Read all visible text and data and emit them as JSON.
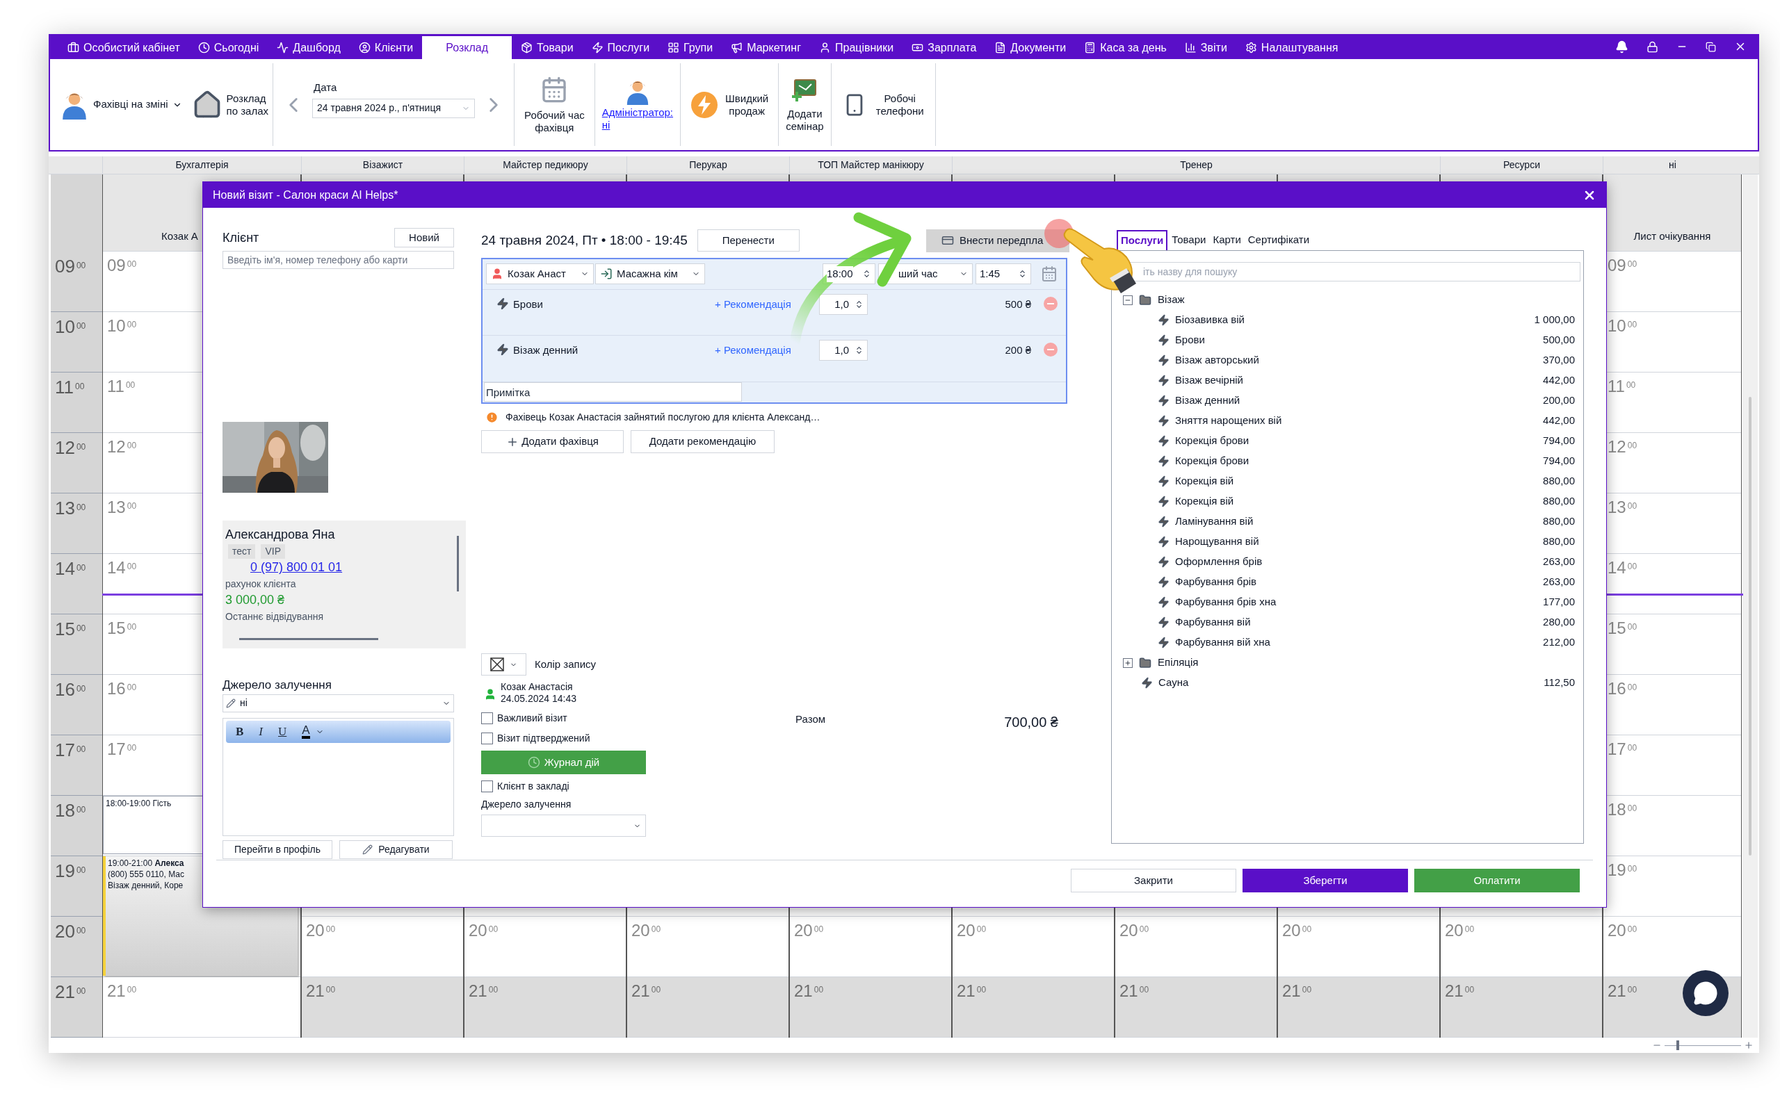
{
  "menu": [
    {
      "label": "Особистий кабінет",
      "selected": false
    },
    {
      "label": "Сьогодні",
      "selected": false
    },
    {
      "label": "Дашборд",
      "selected": false
    },
    {
      "label": "Клієнти",
      "selected": false
    },
    {
      "label": "Розклад",
      "selected": true
    },
    {
      "label": "Товари",
      "selected": false
    },
    {
      "label": "Послуги",
      "selected": false
    },
    {
      "label": "Групи",
      "selected": false
    },
    {
      "label": "Маркетинг",
      "selected": false
    },
    {
      "label": "Працівники",
      "selected": false
    },
    {
      "label": "Зарплата",
      "selected": false
    },
    {
      "label": "Документи",
      "selected": false
    },
    {
      "label": "Каса за день",
      "selected": false
    },
    {
      "label": "Звіти",
      "selected": false
    },
    {
      "label": "Налаштування",
      "selected": false
    }
  ],
  "toolbar": {
    "staff_on_shift": "Фахівці на зміні",
    "rooms": [
      "Розклад",
      "по залах"
    ],
    "date_label": "Дата",
    "date_value": "24 травня 2024 р., п'ятниця",
    "work_hours": [
      "Робочий час",
      "фахівця"
    ],
    "admin": [
      "Адміністратор:",
      "ні"
    ],
    "quick_sale": [
      "Швидкий",
      "продаж"
    ],
    "seminar": [
      "Додати",
      "семінар"
    ],
    "phones": [
      "Робочі",
      "телефони"
    ]
  },
  "calendar": {
    "time_axis": [
      {
        "hour": "09",
        "minutes": "00"
      },
      {
        "hour": "10",
        "minutes": "00"
      },
      {
        "hour": "11",
        "minutes": "00"
      },
      {
        "hour": "12",
        "minutes": "00"
      },
      {
        "hour": "13",
        "minutes": "00"
      },
      {
        "hour": "14",
        "minutes": "00"
      },
      {
        "hour": "15",
        "minutes": "00"
      },
      {
        "hour": "16",
        "minutes": "00"
      },
      {
        "hour": "17",
        "minutes": "00"
      },
      {
        "hour": "18",
        "minutes": "00"
      },
      {
        "hour": "19",
        "minutes": "00"
      },
      {
        "hour": "20",
        "minutes": "00"
      },
      {
        "hour": "21",
        "minutes": "00"
      }
    ],
    "groups": [
      {
        "label": "Бухгалтерія",
        "columns": [
          {
            "name": "Козак А",
            "slots": [
              {
                "kind": "hour",
                "hour": "09",
                "minutes": "00"
              },
              {
                "kind": "hour",
                "hour": "10",
                "minutes": "00"
              },
              {
                "kind": "hour",
                "hour": "11",
                "minutes": "00"
              },
              {
                "kind": "hour",
                "hour": "12",
                "minutes": "00"
              },
              {
                "kind": "hour",
                "hour": "13",
                "minutes": "00"
              },
              {
                "kind": "hour",
                "hour": "14",
                "minutes": "00"
              },
              {
                "kind": "hour",
                "hour": "15",
                "minutes": "00"
              },
              {
                "kind": "hour",
                "hour": "16",
                "minutes": "00"
              },
              {
                "kind": "hour",
                "hour": "17",
                "minutes": "00"
              },
              {
                "kind": "event",
                "lines": [
                  "18:00-19:00  Гість"
                ]
              },
              {
                "kind": "long_event",
                "lines": [
                  "19:00-21:00 **Алекса**",
                  "(800) 555 0110, Мас",
                  "Візаж денний, Коре"
                ]
              },
              {
                "kind": "hour",
                "hour": "21",
                "minutes": "00"
              }
            ]
          }
        ]
      },
      {
        "label": "Візажист",
        "columns": [
          {
            "hour_labels": [
              {
                "hour": "20",
                "minutes": "00",
                "off": false
              },
              {
                "hour": "21",
                "minutes": "00",
                "off": true
              }
            ]
          }
        ]
      },
      {
        "label": "Майстер педикюру",
        "columns": [
          {
            "hour_labels": [
              {
                "hour": "20",
                "minutes": "00",
                "off": false
              },
              {
                "hour": "21",
                "minutes": "00",
                "off": true
              }
            ]
          }
        ]
      },
      {
        "label": "Перукар",
        "columns": [
          {
            "hour_labels": [
              {
                "hour": "20",
                "minutes": "00",
                "off": false
              },
              {
                "hour": "21",
                "minutes": "00",
                "off": true
              }
            ]
          }
        ]
      },
      {
        "label": "ТОП Майстер манікюру",
        "columns": [
          {
            "hour_labels": [
              {
                "hour": "20",
                "minutes": "00",
                "off": false
              },
              {
                "hour": "21",
                "minutes": "00",
                "off": true
              }
            ]
          }
        ]
      },
      {
        "label": "Тренер",
        "columns": [
          {
            "hour_labels": [
              {
                "hour": "20",
                "minutes": "00",
                "off": false
              },
              {
                "hour": "21",
                "minutes": "00",
                "off": true
              }
            ]
          },
          {
            "hour_labels": [
              {
                "hour": "20",
                "minutes": "00",
                "off": false
              },
              {
                "hour": "21",
                "minutes": "00",
                "off": true
              }
            ]
          },
          {
            "hour_labels": [
              {
                "hour": "20",
                "minutes": "00",
                "off": false
              },
              {
                "hour": "21",
                "minutes": "00",
                "off": true
              }
            ]
          }
        ]
      },
      {
        "label": "Ресурси",
        "columns": [
          {
            "hour_labels": [
              {
                "hour": "20",
                "minutes": "00",
                "off": false
              },
              {
                "hour": "21",
                "minutes": "00",
                "off": true
              }
            ]
          }
        ]
      },
      {
        "label": "ні",
        "columns": [
          {
            "name": "Лист очікування",
            "hour_labels": [
              {
                "hour": "09",
                "minutes": "00",
                "off": false
              },
              {
                "hour": "10",
                "minutes": "00",
                "off": false
              },
              {
                "hour": "11",
                "minutes": "00",
                "off": false
              },
              {
                "hour": "12",
                "minutes": "00",
                "off": false
              },
              {
                "hour": "13",
                "minutes": "00",
                "off": false
              },
              {
                "hour": "14",
                "minutes": "00",
                "off": false
              },
              {
                "hour": "15",
                "minutes": "00",
                "off": false
              },
              {
                "hour": "16",
                "minutes": "00",
                "off": false
              },
              {
                "hour": "17",
                "minutes": "00",
                "off": false
              },
              {
                "hour": "18",
                "minutes": "00",
                "off": false
              },
              {
                "hour": "19",
                "minutes": "00",
                "off": false
              },
              {
                "hour": "20",
                "minutes": "00",
                "off": false
              },
              {
                "hour": "21",
                "minutes": "00",
                "off": true
              }
            ]
          }
        ]
      }
    ]
  },
  "zoom_slider": {
    "level": 0.15
  },
  "dialog": {
    "title": "Новий візит - Салон краси AI Helps*",
    "client": {
      "label": "Клієнт",
      "new_button": "Новий",
      "search_placeholder": "Введіть ім'я, номер телефону або карти",
      "name": "Александрова Яна",
      "tags": [
        {
          "label": "тест"
        },
        {
          "label": "VIP"
        }
      ],
      "phone": "0 (97) 800 01 01",
      "account_label": "рахунок клієнта",
      "balance": "3 000,00 ₴",
      "last_visit_label": "Останнє відвідування",
      "source_label": "Джерело залучення",
      "source_value": "ні",
      "format_buttons": [
        {
          "kind": "bold",
          "label": "B"
        },
        {
          "kind": "italic",
          "label": "I"
        },
        {
          "kind": "underline",
          "label": "U"
        },
        {
          "kind": "color",
          "label": "A"
        }
      ],
      "profile_button": "Перейти в профіль",
      "edit_button": "Редагувати"
    },
    "visit": {
      "heading": "24 травня 2024, Пт • 18:00 - 19:45",
      "move_button": "Перенести",
      "prepay_button": "Внести передпла",
      "staff": "Козак Анаст",
      "room": "Масажна кім",
      "start_time": "18:00",
      "time_mode": "ший час",
      "duration": "1:45",
      "services": [
        {
          "name": "Брови",
          "recommend": "+ Рекомендація",
          "quantity": "1,0",
          "price": "500 ₴"
        },
        {
          "name": "Візаж денний",
          "recommend": "+ Рекомендація",
          "quantity": "1,0",
          "price": "200 ₴"
        }
      ],
      "note_placeholder": "Примітка",
      "warning": "Фахівець Козак Анастасія зайнятий послугою для клієнта Александ…",
      "add_staff_button": "Додати фахівця",
      "add_recommendation_button": "Додати рекомендацію",
      "color_label": "Колір запису",
      "created_by": "Козак Анастасія",
      "created_at": "24.05.2024 14:43",
      "options": [
        {
          "label": "Важливий візит",
          "checked": false
        },
        {
          "label": "Візит підтверджений",
          "checked": false
        }
      ],
      "log_button": "Журнал дій",
      "in_salon": {
        "label": "Клієнт в закладі",
        "checked": false
      },
      "source_label": "Джерело залучення",
      "total_label": "Разом",
      "total": "700,00 ₴"
    },
    "catalog": {
      "tabs": [
        {
          "label": "Послуги",
          "selected": true
        },
        {
          "label": "Товари",
          "selected": false
        },
        {
          "label": "Карти",
          "selected": false
        },
        {
          "label": "Сертифікати",
          "selected": false
        }
      ],
      "search_placeholder": "іть назву для пошуку",
      "tree": [
        {
          "kind": "folder",
          "label": "Візаж",
          "expanded": true,
          "children": [
            {
              "kind": "service",
              "label": "Біозавивка вій",
              "price": "1 000,00"
            },
            {
              "kind": "service",
              "label": "Брови",
              "price": "500,00"
            },
            {
              "kind": "service",
              "label": "Візаж авторський",
              "price": "370,00"
            },
            {
              "kind": "service",
              "label": "Візаж вечірній",
              "price": "442,00"
            },
            {
              "kind": "service",
              "label": "Візаж денний",
              "price": "200,00"
            },
            {
              "kind": "service",
              "label": "Зняття нарощених вій",
              "price": "442,00"
            },
            {
              "kind": "service",
              "label": "Корекція брови",
              "price": "794,00"
            },
            {
              "kind": "service",
              "label": "Корекція брови",
              "price": "794,00"
            },
            {
              "kind": "service",
              "label": "Корекція вій",
              "price": "880,00"
            },
            {
              "kind": "service",
              "label": "Корекція вій",
              "price": "880,00"
            },
            {
              "kind": "service",
              "label": "Ламінування вій",
              "price": "880,00"
            },
            {
              "kind": "service",
              "label": "Нарощування вій",
              "price": "880,00"
            },
            {
              "kind": "service",
              "label": "Оформлення брів",
              "price": "263,00"
            },
            {
              "kind": "service",
              "label": "Фарбування брів",
              "price": "263,00"
            },
            {
              "kind": "service",
              "label": "Фарбування брів хна",
              "price": "177,00"
            },
            {
              "kind": "service",
              "label": "Фарбування вій",
              "price": "280,00"
            },
            {
              "kind": "service",
              "label": "Фарбування вій хна",
              "price": "212,00"
            }
          ]
        },
        {
          "kind": "folder",
          "label": "Епіляція",
          "expanded": false
        },
        {
          "kind": "service",
          "label": "Сауна",
          "price": "112,50"
        }
      ]
    },
    "footer": {
      "close": "Закрити",
      "save": "Зберегти",
      "pay": "Оплатити"
    }
  }
}
